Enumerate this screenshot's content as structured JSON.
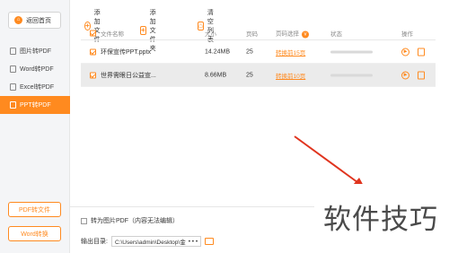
{
  "sidebar": {
    "back_label": "返回首页",
    "items": [
      {
        "label": "图片转PDF"
      },
      {
        "label": "Word转PDF"
      },
      {
        "label": "Excel转PDF"
      },
      {
        "label": "PPT转PDF"
      }
    ],
    "active_index": 3,
    "bottom_buttons": [
      {
        "label": "PDF转文件"
      },
      {
        "label": "Word转换"
      }
    ]
  },
  "toolbar": {
    "add_file": "添加文件",
    "add_folder": "添加文件夹",
    "clear_list": "清空列表"
  },
  "table": {
    "headers": {
      "name": "文件名称",
      "size": "大小",
      "pages": "页码",
      "range": "页码选择",
      "range_badge": "v",
      "status": "状态",
      "action": "操作"
    },
    "rows": [
      {
        "name": "环保宣传PPT.pptx",
        "size": "14.24MB",
        "pages": "25",
        "range": "转换前15页",
        "progress": 0
      },
      {
        "name": "世界需眼日公益宣...",
        "size": "8.66MB",
        "pages": "25",
        "range": "转换前10页",
        "progress": 0
      }
    ]
  },
  "footer": {
    "convert_to_image_label": "转为图片PDF（内容无法编辑）",
    "output_label": "输出目录:",
    "output_path": "C:\\Users\\admin\\Desktop\\金",
    "more_label": "• • •"
  },
  "watermark": {
    "text": "软件技巧"
  },
  "colors": {
    "accent": "#ff8a1f",
    "arrow": "#e0341e"
  },
  "icons": {
    "back": "home-icon",
    "add_file": "plus-circle-icon",
    "add_folder": "plus-square-icon",
    "clear": "broom-icon",
    "open": "play-circle-icon",
    "delete": "trash-icon",
    "folder": "folder-icon"
  }
}
